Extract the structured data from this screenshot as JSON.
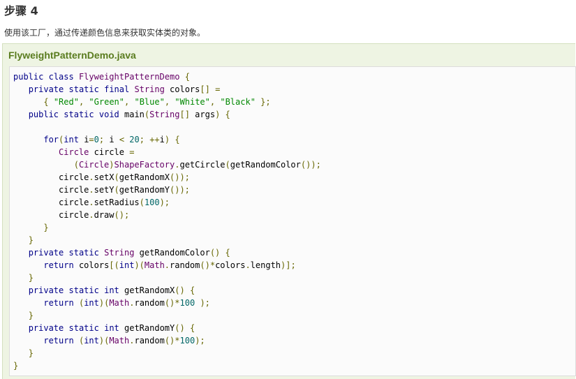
{
  "step": {
    "heading": "步骤 4",
    "description": "使用该工厂，通过传递颜色信息来获取实体类的对象。"
  },
  "example": {
    "filename": "FlyweightPatternDemo.java"
  },
  "code_lines": [
    [
      [
        "kw",
        "public"
      ],
      [
        "pln",
        " "
      ],
      [
        "kw",
        "class"
      ],
      [
        "pln",
        " "
      ],
      [
        "typ",
        "FlyweightPatternDemo"
      ],
      [
        "pln",
        " "
      ],
      [
        "pun",
        "{"
      ]
    ],
    [
      [
        "pln",
        "   "
      ],
      [
        "kw",
        "private"
      ],
      [
        "pln",
        " "
      ],
      [
        "kw",
        "static"
      ],
      [
        "pln",
        " "
      ],
      [
        "kw",
        "final"
      ],
      [
        "pln",
        " "
      ],
      [
        "typ",
        "String"
      ],
      [
        "pln",
        " colors"
      ],
      [
        "pun",
        "[]"
      ],
      [
        "pln",
        " "
      ],
      [
        "pun",
        "="
      ]
    ],
    [
      [
        "pln",
        "      "
      ],
      [
        "pun",
        "{"
      ],
      [
        "pln",
        " "
      ],
      [
        "str",
        "\"Red\""
      ],
      [
        "pun",
        ","
      ],
      [
        "pln",
        " "
      ],
      [
        "str",
        "\"Green\""
      ],
      [
        "pun",
        ","
      ],
      [
        "pln",
        " "
      ],
      [
        "str",
        "\"Blue\""
      ],
      [
        "pun",
        ","
      ],
      [
        "pln",
        " "
      ],
      [
        "str",
        "\"White\""
      ],
      [
        "pun",
        ","
      ],
      [
        "pln",
        " "
      ],
      [
        "str",
        "\"Black\""
      ],
      [
        "pln",
        " "
      ],
      [
        "pun",
        "};"
      ]
    ],
    [
      [
        "pln",
        "   "
      ],
      [
        "kw",
        "public"
      ],
      [
        "pln",
        " "
      ],
      [
        "kw",
        "static"
      ],
      [
        "pln",
        " "
      ],
      [
        "kw",
        "void"
      ],
      [
        "pln",
        " main"
      ],
      [
        "pun",
        "("
      ],
      [
        "typ",
        "String"
      ],
      [
        "pun",
        "[]"
      ],
      [
        "pln",
        " args"
      ],
      [
        "pun",
        ")"
      ],
      [
        "pln",
        " "
      ],
      [
        "pun",
        "{"
      ]
    ],
    [
      [
        "pln",
        " "
      ]
    ],
    [
      [
        "pln",
        "      "
      ],
      [
        "kw",
        "for"
      ],
      [
        "pun",
        "("
      ],
      [
        "kw",
        "int"
      ],
      [
        "pln",
        " i"
      ],
      [
        "pun",
        "="
      ],
      [
        "lit",
        "0"
      ],
      [
        "pun",
        ";"
      ],
      [
        "pln",
        " i "
      ],
      [
        "pun",
        "<"
      ],
      [
        "pln",
        " "
      ],
      [
        "lit",
        "20"
      ],
      [
        "pun",
        ";"
      ],
      [
        "pln",
        " "
      ],
      [
        "pun",
        "++"
      ],
      [
        "pln",
        "i"
      ],
      [
        "pun",
        ")"
      ],
      [
        "pln",
        " "
      ],
      [
        "pun",
        "{"
      ]
    ],
    [
      [
        "pln",
        "         "
      ],
      [
        "typ",
        "Circle"
      ],
      [
        "pln",
        " circle "
      ],
      [
        "pun",
        "="
      ]
    ],
    [
      [
        "pln",
        "            "
      ],
      [
        "pun",
        "("
      ],
      [
        "typ",
        "Circle"
      ],
      [
        "pun",
        ")"
      ],
      [
        "typ",
        "ShapeFactory"
      ],
      [
        "pun",
        "."
      ],
      [
        "pln",
        "getCircle"
      ],
      [
        "pun",
        "("
      ],
      [
        "pln",
        "getRandomColor"
      ],
      [
        "pun",
        "());"
      ]
    ],
    [
      [
        "pln",
        "         circle"
      ],
      [
        "pun",
        "."
      ],
      [
        "pln",
        "setX"
      ],
      [
        "pun",
        "("
      ],
      [
        "pln",
        "getRandomX"
      ],
      [
        "pun",
        "());"
      ]
    ],
    [
      [
        "pln",
        "         circle"
      ],
      [
        "pun",
        "."
      ],
      [
        "pln",
        "setY"
      ],
      [
        "pun",
        "("
      ],
      [
        "pln",
        "getRandomY"
      ],
      [
        "pun",
        "());"
      ]
    ],
    [
      [
        "pln",
        "         circle"
      ],
      [
        "pun",
        "."
      ],
      [
        "pln",
        "setRadius"
      ],
      [
        "pun",
        "("
      ],
      [
        "lit",
        "100"
      ],
      [
        "pun",
        ");"
      ]
    ],
    [
      [
        "pln",
        "         circle"
      ],
      [
        "pun",
        "."
      ],
      [
        "pln",
        "draw"
      ],
      [
        "pun",
        "();"
      ]
    ],
    [
      [
        "pln",
        "      "
      ],
      [
        "pun",
        "}"
      ]
    ],
    [
      [
        "pln",
        "   "
      ],
      [
        "pun",
        "}"
      ]
    ],
    [
      [
        "pln",
        "   "
      ],
      [
        "kw",
        "private"
      ],
      [
        "pln",
        " "
      ],
      [
        "kw",
        "static"
      ],
      [
        "pln",
        " "
      ],
      [
        "typ",
        "String"
      ],
      [
        "pln",
        " getRandomColor"
      ],
      [
        "pun",
        "()"
      ],
      [
        "pln",
        " "
      ],
      [
        "pun",
        "{"
      ]
    ],
    [
      [
        "pln",
        "      "
      ],
      [
        "kw",
        "return"
      ],
      [
        "pln",
        " colors"
      ],
      [
        "pun",
        "[("
      ],
      [
        "kw",
        "int"
      ],
      [
        "pun",
        ")("
      ],
      [
        "typ",
        "Math"
      ],
      [
        "pun",
        "."
      ],
      [
        "pln",
        "random"
      ],
      [
        "pun",
        "()*"
      ],
      [
        "pln",
        "colors"
      ],
      [
        "pun",
        "."
      ],
      [
        "pln",
        "length"
      ],
      [
        "pun",
        ")];"
      ]
    ],
    [
      [
        "pln",
        "   "
      ],
      [
        "pun",
        "}"
      ]
    ],
    [
      [
        "pln",
        "   "
      ],
      [
        "kw",
        "private"
      ],
      [
        "pln",
        " "
      ],
      [
        "kw",
        "static"
      ],
      [
        "pln",
        " "
      ],
      [
        "kw",
        "int"
      ],
      [
        "pln",
        " getRandomX"
      ],
      [
        "pun",
        "()"
      ],
      [
        "pln",
        " "
      ],
      [
        "pun",
        "{"
      ]
    ],
    [
      [
        "pln",
        "      "
      ],
      [
        "kw",
        "return"
      ],
      [
        "pln",
        " "
      ],
      [
        "pun",
        "("
      ],
      [
        "kw",
        "int"
      ],
      [
        "pun",
        ")("
      ],
      [
        "typ",
        "Math"
      ],
      [
        "pun",
        "."
      ],
      [
        "pln",
        "random"
      ],
      [
        "pun",
        "()*"
      ],
      [
        "lit",
        "100"
      ],
      [
        "pln",
        " "
      ],
      [
        "pun",
        ");"
      ]
    ],
    [
      [
        "pln",
        "   "
      ],
      [
        "pun",
        "}"
      ]
    ],
    [
      [
        "pln",
        "   "
      ],
      [
        "kw",
        "private"
      ],
      [
        "pln",
        " "
      ],
      [
        "kw",
        "static"
      ],
      [
        "pln",
        " "
      ],
      [
        "kw",
        "int"
      ],
      [
        "pln",
        " getRandomY"
      ],
      [
        "pun",
        "()"
      ],
      [
        "pln",
        " "
      ],
      [
        "pun",
        "{"
      ]
    ],
    [
      [
        "pln",
        "      "
      ],
      [
        "kw",
        "return"
      ],
      [
        "pln",
        " "
      ],
      [
        "pun",
        "("
      ],
      [
        "kw",
        "int"
      ],
      [
        "pun",
        ")("
      ],
      [
        "typ",
        "Math"
      ],
      [
        "pun",
        "."
      ],
      [
        "pln",
        "random"
      ],
      [
        "pun",
        "()*"
      ],
      [
        "lit",
        "100"
      ],
      [
        "pun",
        ");"
      ]
    ],
    [
      [
        "pln",
        "   "
      ],
      [
        "pun",
        "}"
      ]
    ],
    [
      [
        "pun",
        "}"
      ]
    ]
  ]
}
